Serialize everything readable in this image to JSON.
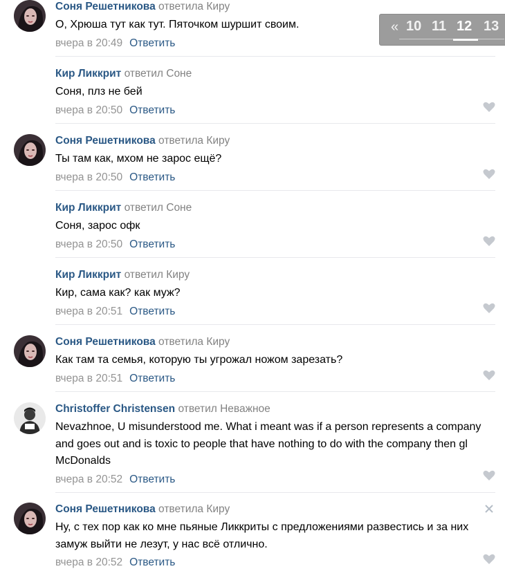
{
  "colors": {
    "link": "#2a5885",
    "muted": "#828282",
    "date": "#939393",
    "divider": "#e7e8ec",
    "pager_bg": "#9c9c9c"
  },
  "icons": {
    "like": "heart-icon",
    "remove": "close-icon"
  },
  "pager": {
    "prev": "«",
    "pages": [
      "10",
      "11",
      "12",
      "13"
    ],
    "current": "12"
  },
  "comments": [
    {
      "author": "Соня Решетникова",
      "reply_to": "ответила Киру",
      "text": "О, Хрюша тут как тут. Пяточком шуршит своим.",
      "date": "вчера в 20:49",
      "reply": "Ответить",
      "avatar": "sonya"
    },
    {
      "author": "Кир Ликкрит",
      "reply_to": "ответил Соне",
      "text": "Соня, плз не бей",
      "date": "вчера в 20:50",
      "reply": "Ответить",
      "avatar": ""
    },
    {
      "author": "Соня Решетникова",
      "reply_to": "ответила Киру",
      "text": "Ты там как, мхом не зарос ещё?",
      "date": "вчера в 20:50",
      "reply": "Ответить",
      "avatar": "sonya"
    },
    {
      "author": "Кир Ликкрит",
      "reply_to": "ответил Соне",
      "text": "Соня, зарос офк",
      "date": "вчера в 20:50",
      "reply": "Ответить",
      "avatar": ""
    },
    {
      "author": "Кир Ликкрит",
      "reply_to": "ответил Киру",
      "text": "Кир, сама как? как муж?",
      "date": "вчера в 20:51",
      "reply": "Ответить",
      "avatar": ""
    },
    {
      "author": "Соня Решетникова",
      "reply_to": "ответила Киру",
      "text": "Как там та семья, которую ты угрожал ножом зарезать?",
      "date": "вчера в 20:51",
      "reply": "Ответить",
      "avatar": "sonya"
    },
    {
      "author": "Christoffer Christensen",
      "reply_to": "ответил Неважное",
      "text": "Nevazhnoe, U misunderstood me. What i meant was if a person represents a company and goes out and is toxic to people that have nothing to do with the company then gl McDonalds",
      "date": "вчера в 20:52",
      "reply": "Ответить",
      "avatar": "christoffer"
    },
    {
      "author": "Соня Решетникова",
      "reply_to": "ответила Киру",
      "text": "Ну, с тех пор как ко мне пьяные Ликкриты с предложениями развестись и за них замуж выйти не лезут, у нас всё отлично.",
      "date": "вчера в 20:52",
      "reply": "Ответить",
      "avatar": "sonya"
    }
  ]
}
